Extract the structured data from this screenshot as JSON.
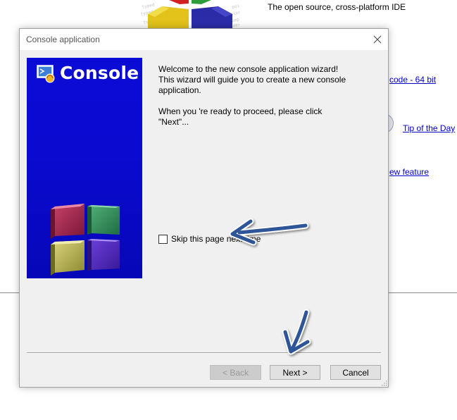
{
  "background": {
    "tagline": "The open source, cross-platform IDE",
    "links": {
      "download": "code - 64 bit",
      "tip": "Tip of the Day",
      "feature": "ew feature"
    }
  },
  "dialog": {
    "title": "Console application",
    "banner_title": "Console",
    "intro_line1": "Welcome to the new console application wizard!\nThis wizard will guide you to create a new console application.",
    "intro_line2": "When you 're ready to proceed, please click \"Next\"...",
    "skip_label": "Skip this page next time",
    "buttons": {
      "back": "< Back",
      "next": "Next >",
      "cancel": "Cancel"
    },
    "back_enabled": false,
    "skip_checked": false
  },
  "colors": {
    "banner_blue": "#0a0ad0",
    "link_blue": "#0000cc",
    "arrow_blue": "#2f5597"
  }
}
